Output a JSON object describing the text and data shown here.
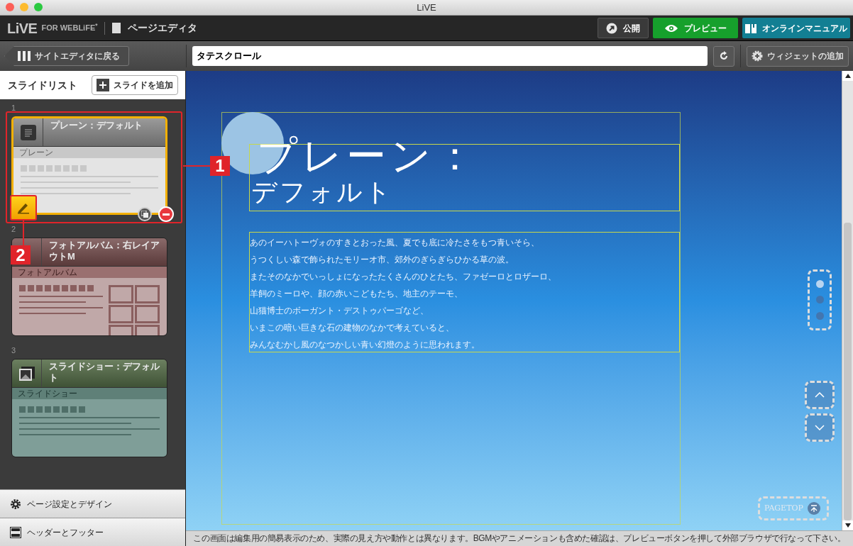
{
  "window": {
    "title": "LiVE"
  },
  "app_bar": {
    "logo": "LiVE",
    "logo_sub": "FOR WEBLiFE$^{*}$",
    "page_title": "ページエディタ",
    "buttons": [
      {
        "label": "公開",
        "kind": "publish"
      },
      {
        "label": "プレビュー",
        "kind": "preview"
      },
      {
        "label": "オンラインマニュアル",
        "kind": "manual"
      }
    ]
  },
  "toolbar": {
    "back": "サイトエディタに戻る",
    "page_name": "タテスクロール",
    "add_widget": "ウィジェットの追加"
  },
  "sidebar": {
    "title": "スライドリスト",
    "add_button": "スライドを追加",
    "slides": [
      {
        "number": "1",
        "title": "プレーン：デフォルト",
        "type_label": "プレーン",
        "kind": "plain",
        "selected": true
      },
      {
        "number": "2",
        "title": "フォトアルバム：右レイアウトM",
        "type_label": "フォトアルバム",
        "kind": "photo",
        "selected": false
      },
      {
        "number": "3",
        "title": "スライドショー：デフォルト",
        "type_label": "スライドショー",
        "kind": "slideshow",
        "selected": false
      }
    ],
    "footer_items": [
      {
        "label": "ページ設定とデザイン",
        "kind": "settings"
      },
      {
        "label": "ヘッダーとフッター",
        "kind": "layout"
      }
    ]
  },
  "callouts": [
    "1",
    "2"
  ],
  "preview": {
    "heading_line1": "プレーン：",
    "heading_line2": "デフォルト",
    "body_lines": [
      "あのイーハトーヴォのすきとおった風、夏でも底に冷たさをもつ青いそら、",
      "うつくしい森で飾られたモリーオ市、郊外のぎらぎらひかる草の波。",
      "またそのなかでいっしょになったたくさんのひとたち、ファゼーロとロザーロ、",
      "羊飼のミーロや、顔の赤いこどもたち、地主のテーモ、",
      "山猫博士のボーガント・デストゥパーゴなど、",
      "いまこの暗い巨きな石の建物のなかで考えていると、",
      "みんなむかし風のなつかしい青い幻燈のように思われます。"
    ],
    "nav_dots": [
      {
        "selected": true
      },
      {
        "selected": false
      },
      {
        "selected": false
      }
    ],
    "pagetop": "PAGETOP"
  },
  "status_bar": "この画面は編集用の簡易表示のため、実際の見え方や動作とは異なります。BGMやアニメーションも含めた確認は、プレビューボタンを押して外部ブラウザで行なって下さい。"
}
